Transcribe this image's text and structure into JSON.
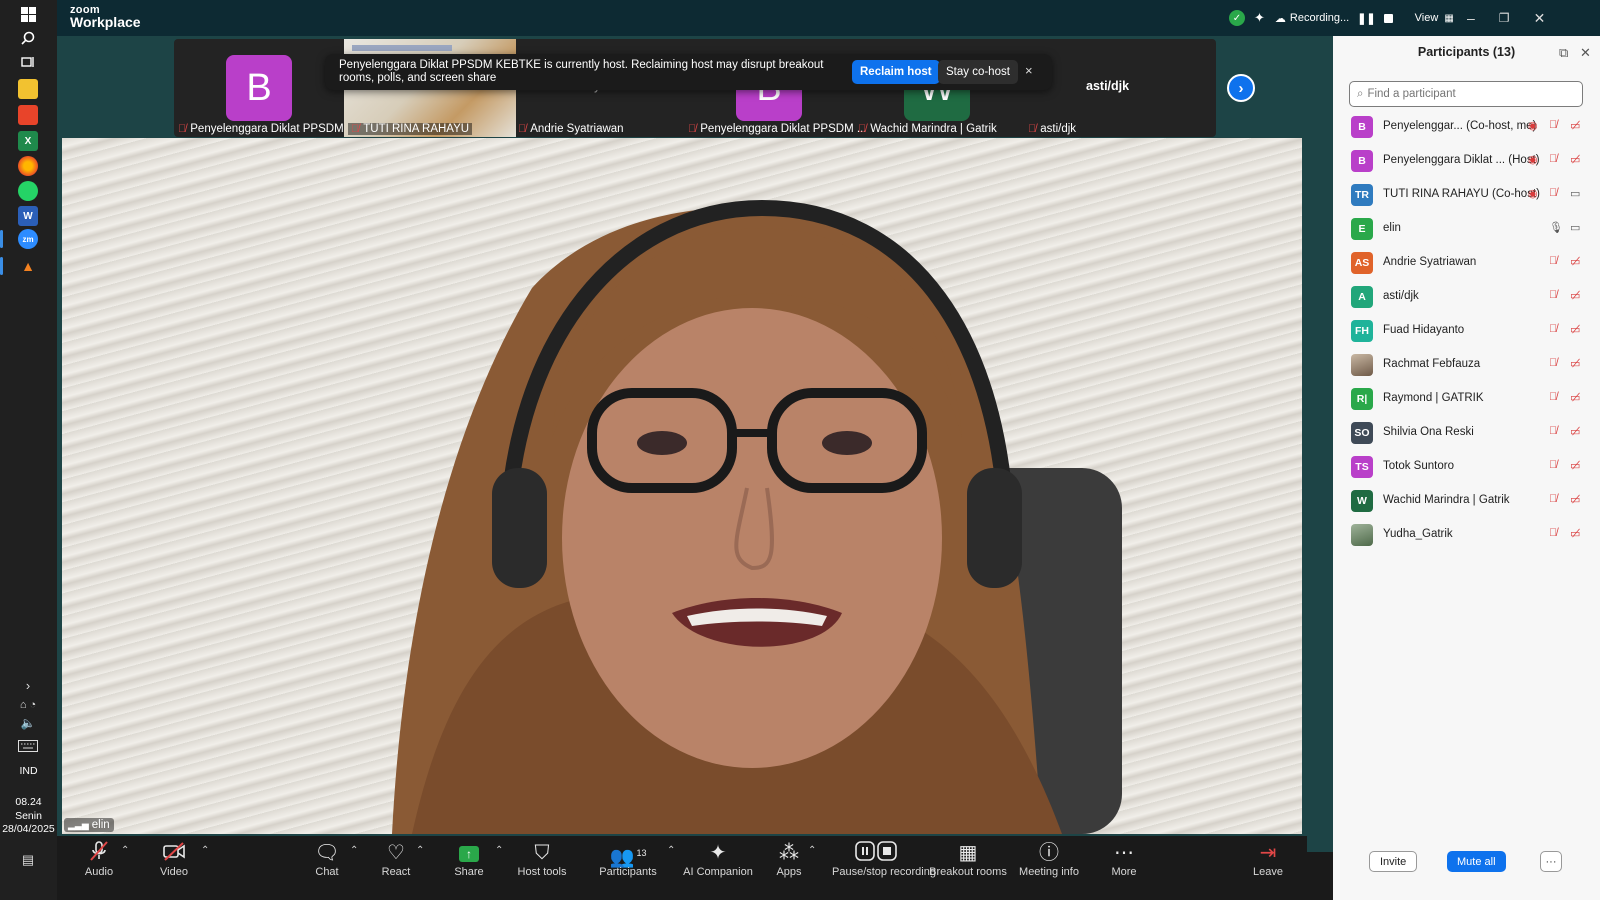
{
  "taskbar": {
    "icons": [
      "windows-start-icon",
      "search-icon",
      "task-view-icon",
      "file-explorer-icon",
      "office-icon",
      "excel-icon",
      "firefox-icon",
      "whatsapp-icon",
      "word-icon",
      "zoom-icon",
      "vlc-icon"
    ],
    "lang": "IND",
    "time": "08.24",
    "day": "Senin",
    "date": "28/04/2025"
  },
  "titlebar": {
    "logo_top": "zoom",
    "logo_bottom": "Workplace",
    "recording": "Recording...",
    "view": "View"
  },
  "toast": {
    "message": "Penyelenggara Diklat PPSDM KEBTKE is currently host. Reclaiming host may disrupt breakout rooms, polls, and screen share",
    "reclaim": "Reclaim host",
    "stay": "Stay co-host",
    "close": "×"
  },
  "strip": {
    "tiles": [
      {
        "avatar": "B",
        "color": "#b93fc9",
        "name": "Penyelenggara Diklat PPSDM ..."
      },
      {
        "avatar": "",
        "color": "#b9a88d",
        "name": "TUTI RINA RAHAYU"
      },
      {
        "avatar": "",
        "color": "",
        "name": "Andrie Syatriawan",
        "overlay": "Andrie Syatriawan"
      },
      {
        "avatar": "B",
        "color": "#b93fc9",
        "name": "Penyelenggara Diklat PPSDM ..."
      },
      {
        "avatar": "W",
        "color": "#1f6b42",
        "name": "Wachid Marindra | Gatrik"
      },
      {
        "avatar": "",
        "color": "",
        "name": "asti/djk",
        "overlay": "asti/djk"
      }
    ]
  },
  "main_video": {
    "name": "elin"
  },
  "toolbar": {
    "items": [
      {
        "label": "Audio",
        "icon": "microphone-muted-icon"
      },
      {
        "label": "Video",
        "icon": "video-off-icon"
      },
      {
        "label": "Chat",
        "icon": "chat-icon"
      },
      {
        "label": "React",
        "icon": "heart-icon"
      },
      {
        "label": "Share",
        "icon": "share-screen-icon"
      },
      {
        "label": "Host tools",
        "icon": "shield-icon"
      },
      {
        "label": "Participants",
        "icon": "participants-icon",
        "count": "13"
      },
      {
        "label": "AI Companion",
        "icon": "sparkle-icon"
      },
      {
        "label": "Apps",
        "icon": "apps-icon"
      },
      {
        "label": "Pause/stop recording",
        "icon": "pause-stop-recording-icon"
      },
      {
        "label": "Breakout rooms",
        "icon": "breakout-rooms-icon"
      },
      {
        "label": "Meeting info",
        "icon": "info-icon"
      },
      {
        "label": "More",
        "icon": "more-icon"
      },
      {
        "label": "Leave",
        "icon": "leave-icon"
      }
    ]
  },
  "panel": {
    "title": "Participants (13)",
    "search_placeholder": "Find a participant",
    "participants": [
      {
        "initials": "B",
        "color": "#b93fc9",
        "name": "Penyelenggar...  (Co-host, me)",
        "mic": "muted",
        "cam": "off",
        "extra": true
      },
      {
        "initials": "B",
        "color": "#b93fc9",
        "name": "Penyelenggara Diklat ...  (Host)",
        "mic": "muted",
        "cam": "off",
        "extra": true
      },
      {
        "initials": "TR",
        "color": "#2f7bbf",
        "name": "TUTI RINA RAHAYU (Co-host)",
        "mic": "muted",
        "cam": "on",
        "extra": true
      },
      {
        "initials": "E",
        "color": "#2aa84a",
        "name": "elin",
        "mic": "on",
        "cam": "on",
        "extra": false
      },
      {
        "initials": "AS",
        "color": "#e0632a",
        "name": "Andrie Syatriawan",
        "mic": "muted",
        "cam": "off",
        "extra": false
      },
      {
        "initials": "A",
        "color": "#21a67a",
        "name": "asti/djk",
        "mic": "muted",
        "cam": "off",
        "extra": false
      },
      {
        "initials": "FH",
        "color": "#1fb39a",
        "name": "Fuad Hidayanto",
        "mic": "muted",
        "cam": "off",
        "extra": false
      },
      {
        "initials": "",
        "color": "#8a7a6a",
        "name": "Rachmat Febfauza",
        "mic": "muted",
        "cam": "off",
        "extra": false
      },
      {
        "initials": "R|",
        "color": "#2aa84a",
        "name": "Raymond | GATRIK",
        "mic": "muted",
        "cam": "off",
        "extra": false
      },
      {
        "initials": "SO",
        "color": "#3f4a57",
        "name": "Shilvia Ona Reski",
        "mic": "muted",
        "cam": "off",
        "extra": false
      },
      {
        "initials": "TS",
        "color": "#b93fc9",
        "name": "Totok Suntoro",
        "mic": "muted",
        "cam": "off",
        "extra": false
      },
      {
        "initials": "W",
        "color": "#1f6b42",
        "name": "Wachid Marindra | Gatrik",
        "mic": "muted",
        "cam": "off",
        "extra": false
      },
      {
        "initials": "",
        "color": "#6f8a6a",
        "name": "Yudha_Gatrik",
        "mic": "muted",
        "cam": "off",
        "extra": false
      }
    ],
    "invite": "Invite",
    "mute_all": "Mute all",
    "more": "···"
  }
}
